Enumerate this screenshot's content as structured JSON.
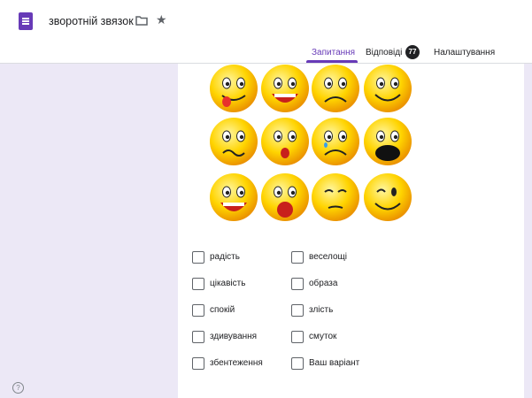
{
  "header": {
    "form_title": "зворотній звязок",
    "icons": [
      "forms-app-icon",
      "folder-icon",
      "star-icon"
    ]
  },
  "tabs": {
    "questions": "Запитання",
    "responses": "Відповіді",
    "responses_count": "77",
    "settings": "Налаштування"
  },
  "colors": {
    "accent": "#673ab7",
    "background": "#ece8f6",
    "emoji_yellow": "#ffd400"
  },
  "emojis": [
    "tongue-out-emoji",
    "laughing-emoji",
    "sad-emoji",
    "smiling-emoji",
    "confused-emoji",
    "shocked-emoji",
    "crying-emoji",
    "screaming-emoji",
    "grinning-emoji",
    "yawning-emoji",
    "sleepy-emoji",
    "winking-emoji"
  ],
  "options": [
    "радість",
    "веселощі",
    "цікавість",
    "образа",
    "спокій",
    "злість",
    "здивування",
    "смуток",
    "збентеження",
    "Ваш варіант"
  ],
  "help_icon": "help-icon"
}
